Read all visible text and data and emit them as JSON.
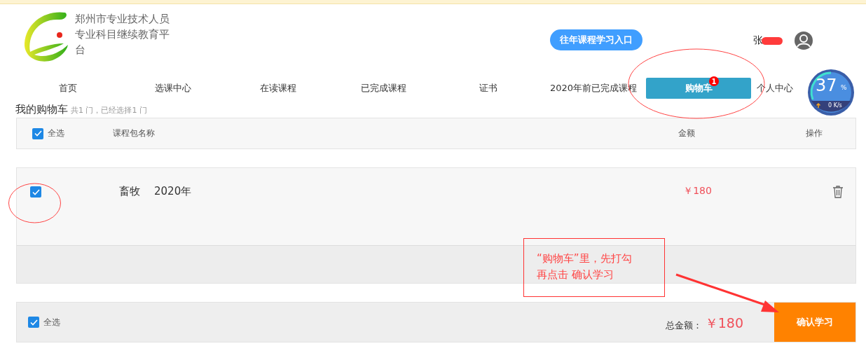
{
  "header": {
    "title": "郑州市专业技术人员专业科目继续教育平台",
    "past_courses_button": "往年课程学习入口",
    "user_name": "张"
  },
  "nav": [
    {
      "label": "首页",
      "selected": false
    },
    {
      "label": "选课中心",
      "selected": false
    },
    {
      "label": "在读课程",
      "selected": false
    },
    {
      "label": "已完成课程",
      "selected": false
    },
    {
      "label": "证书",
      "selected": false
    },
    {
      "label": "2020年前已完成课程",
      "selected": false
    },
    {
      "label": "购物车",
      "selected": true,
      "badge": "1"
    },
    {
      "label": "个人中心",
      "selected": false
    }
  ],
  "speed_widget": {
    "percent": "37",
    "unit": "%",
    "rate": "0 K/s"
  },
  "cart": {
    "title": "我的购物车",
    "summary": "共1 门，已经选择1 门",
    "header_row": {
      "select_all": {
        "label": "全选",
        "checked": true
      },
      "columns": [
        "课程包名称",
        "金额",
        "操作"
      ]
    },
    "items": [
      {
        "name": "畜牧",
        "year": "2020年",
        "price": "￥180",
        "checked": true
      }
    ],
    "footer": {
      "select_all": {
        "label": "全选",
        "checked": true
      },
      "total_label": "总金额：",
      "total": "￥180",
      "confirm_button": "确认学习"
    }
  },
  "annotation": {
    "lines": [
      "“购物车”里，先打勾",
      "再点击 确认学习"
    ]
  }
}
